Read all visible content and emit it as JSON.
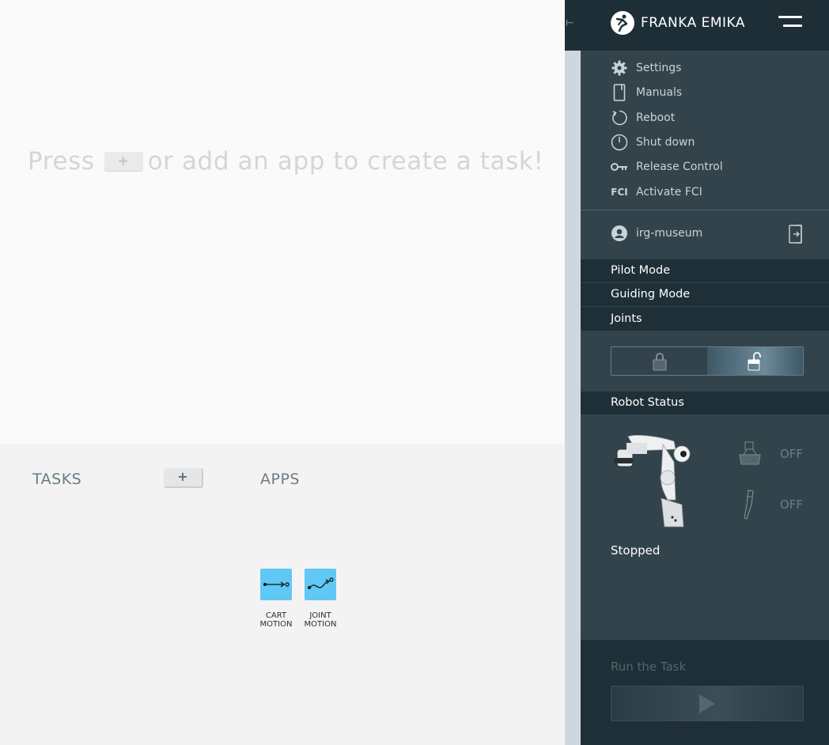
{
  "canvas": {
    "hint_press": "Press",
    "hint_plus": "+",
    "hint_rest": "or add an app to create a task!"
  },
  "bottom": {
    "tasks_title": "TASKS",
    "add_task_label": "+",
    "apps_title": "APPS",
    "apps": [
      {
        "line1": "CART",
        "line2": "MOTION",
        "icon": "cart-motion-icon"
      },
      {
        "line1": "JOINT",
        "line2": "MOTION",
        "icon": "joint-motion-icon"
      }
    ]
  },
  "header": {
    "brand": "FRANKA EMIKA",
    "collapse_glyph": "⊢"
  },
  "menu": {
    "items": [
      {
        "label": "Settings",
        "icon": "gear-icon"
      },
      {
        "label": "Manuals",
        "icon": "book-icon"
      },
      {
        "label": "Reboot",
        "icon": "reboot-icon"
      },
      {
        "label": "Shut down",
        "icon": "power-icon"
      },
      {
        "label": "Release Control",
        "icon": "key-icon"
      },
      {
        "label": "Activate FCI",
        "icon": "fci-icon",
        "icon_text": "FCI"
      }
    ]
  },
  "user": {
    "name": "irg-museum"
  },
  "modes": {
    "pilot": "Pilot Mode",
    "guiding": "Guiding Mode",
    "joints": "Joints"
  },
  "robot_status": {
    "title": "Robot Status",
    "indicator1": "OFF",
    "indicator2": "OFF",
    "state": "Stopped"
  },
  "run": {
    "label": "Run the Task"
  },
  "colors": {
    "app_tile": "#5fc8f5",
    "header_bg": "#1e2e37",
    "panel_bg": "#33434b"
  }
}
